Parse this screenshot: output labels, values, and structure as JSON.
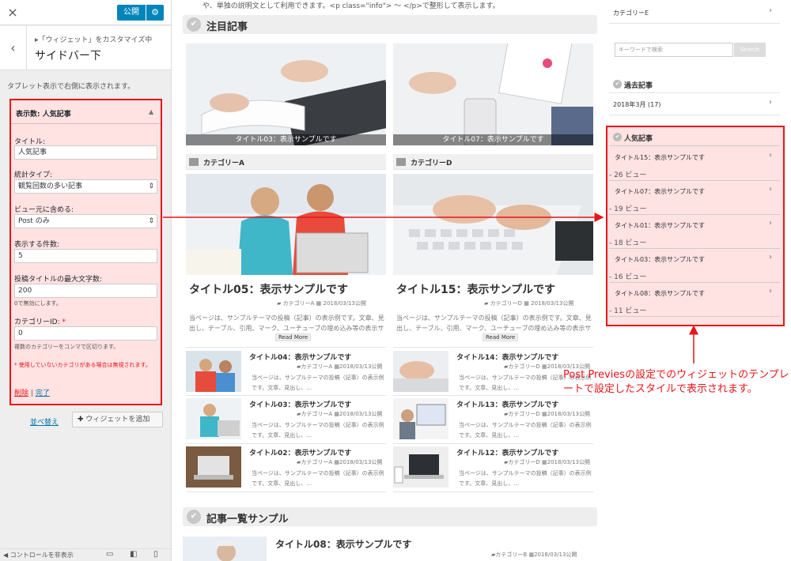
{
  "customizer": {
    "close_icon": "×",
    "publish_label": "公開",
    "gear_icon": "⚙",
    "back_icon": "‹",
    "breadcrumb": "▸「ウィジェット」をカスタマイズ中",
    "title": "サイドバー下",
    "description": "タブレット表示で右側に表示されます。",
    "widget": {
      "header": "表示数: 人気記事",
      "collapse_icon": "▲",
      "fields": [
        {
          "label": "タイトル:",
          "value": "人気記事"
        },
        {
          "label": "統計タイプ:",
          "value": "観覧回数の多い記事"
        },
        {
          "label": "ビュー元に含める:",
          "value": "Post のみ"
        },
        {
          "label": "表示する件数:",
          "value": "5"
        },
        {
          "label": "投稿タイトルの最大文字数:",
          "value": "200",
          "help": "0で無効にします。"
        },
        {
          "label": "カテゴリーID:",
          "required": "*",
          "value": "0",
          "help": "複数のカテゴリーをコンマで区切ります。"
        }
      ],
      "select_arrow": "⇕",
      "warning": "* 使用していないカテゴリがある場合は無視されます。",
      "delete_label": "削除",
      "separator": "|",
      "done_label": "完了"
    },
    "reorder_label": "並べ替え",
    "add_widget_label": "ウィジェットを追加",
    "add_icon": "✚",
    "hide_controls_label": "コントロールを非表示",
    "collapse_icon": "◀",
    "device_icons": [
      "▭",
      "◧",
      "▯"
    ]
  },
  "main": {
    "intro": "や、単独の説明文として利用できます。<p class=\"info\"> 〜 </p>で整形して表示します。",
    "check_icon": "✔",
    "featured_title": "注目記事",
    "featured": [
      {
        "caption": "タイトル03：表示サンプルです"
      },
      {
        "caption": "タイトル07：表示サンプルです"
      }
    ],
    "columns": [
      {
        "category": "カテゴリーA",
        "title": "タイトル05：表示サンプルです",
        "meta_cat": "カテゴリーA",
        "meta_date": "2018/03/13公開",
        "excerpt": "当ページは、サンプルテーマの投稿（記事）の表示例です。文章、見出し、テーブル、引用、マーク、ユーチューブの埋め込み等の表示サンプルを確認できます…",
        "readmore": "Read More",
        "items": [
          {
            "title": "タイトル04：表示サンプルです",
            "cat": "カテゴリーA",
            "date": "2018/03/13公開",
            "excerpt": "当ページは、サンプルテーマの投稿（記事）の表示例です。文章、見出し、…"
          },
          {
            "title": "タイトル03：表示サンプルです",
            "cat": "カテゴリーA",
            "date": "2018/03/13公開",
            "excerpt": "当ページは、サンプルテーマの投稿（記事）の表示例です。文章、見出し、…"
          },
          {
            "title": "タイトル02：表示サンプルです",
            "cat": "カテゴリーA",
            "date": "2018/03/13公開",
            "excerpt": "当ページは、サンプルテーマの投稿（記事）の表示例です。文章、見出し、…"
          }
        ]
      },
      {
        "category": "カテゴリーD",
        "title": "タイトル15：表示サンプルです",
        "meta_cat": "カテゴリーD",
        "meta_date": "2018/03/13公開",
        "excerpt": "当ページは、サンプルテーマの投稿（記事）の表示例です。文章、見出し、テーブル、引用、マーク、ユーチューブの埋め込み等の表示サンプルを確認できます…",
        "readmore": "Read More",
        "items": [
          {
            "title": "タイトル14：表示サンプルです",
            "cat": "カテゴリーD",
            "date": "2018/03/13公開",
            "excerpt": "当ページは、サンプルテーマの投稿（記事）の表示例です。文章、見出し、…"
          },
          {
            "title": "タイトル13：表示サンプルです",
            "cat": "カテゴリーD",
            "date": "2018/03/13公開",
            "excerpt": "当ページは、サンプルテーマの投稿（記事）の表示例です。文章、見出し、…"
          },
          {
            "title": "タイトル12：表示サンプルです",
            "cat": "カテゴリーD",
            "date": "2018/03/13公開",
            "excerpt": "当ページは、サンプルテーマの投稿（記事）の表示例です。文章、見出し、…"
          }
        ]
      }
    ],
    "list_title": "記事一覧サンプル",
    "list_first": {
      "title": "タイトル08：表示サンプルです",
      "cat": "カテゴリーB",
      "date": "2018/03/13公開"
    }
  },
  "sidebar": {
    "category_e": "カテゴリーE",
    "chevron": "›",
    "search_placeholder": "キーワードで検索",
    "search_button": "Search",
    "archive_title": "過去記事",
    "archive_item": "2018年3月 (17)",
    "popular_title": "人気記事",
    "popular": [
      {
        "title": "タイトル15：表示サンプルです",
        "views": "- 26 ビュー"
      },
      {
        "title": "タイトル07：表示サンプルです",
        "views": "- 19 ビュー"
      },
      {
        "title": "タイトル01：表示サンプルです",
        "views": "- 18 ビュー"
      },
      {
        "title": "タイトル03：表示サンプルです",
        "views": "- 16 ビュー"
      },
      {
        "title": "タイトル08：表示サンプルです",
        "views": "- 11 ビュー"
      }
    ]
  },
  "annotation": {
    "text": "Post Previesの設定でのウィジェットのテンプレートで設定したスタイルで表示されます。",
    "color": "#e8141a"
  }
}
